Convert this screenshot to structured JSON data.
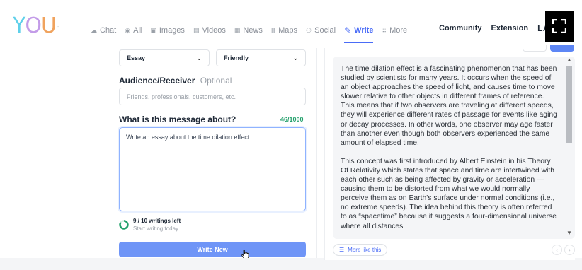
{
  "nav": {
    "logo": {
      "y": "Y",
      "o": "O",
      "u": "U",
      "tm": "™"
    },
    "items": [
      {
        "icon": "chat-icon",
        "glyph": "☁",
        "label": "Chat"
      },
      {
        "icon": "all-icon",
        "glyph": "◉",
        "label": "All"
      },
      {
        "icon": "images-icon",
        "glyph": "▣",
        "label": "Images"
      },
      {
        "icon": "videos-icon",
        "glyph": "▤",
        "label": "Videos"
      },
      {
        "icon": "news-icon",
        "glyph": "▦",
        "label": "News"
      },
      {
        "icon": "maps-icon",
        "glyph": "Ⅲ",
        "label": "Maps"
      },
      {
        "icon": "social-icon",
        "glyph": "⚇",
        "label": "Social"
      },
      {
        "icon": "write-icon",
        "glyph": "✎",
        "label": "Write"
      },
      {
        "icon": "more-icon",
        "glyph": "⠿",
        "label": "More"
      }
    ],
    "active": "Write",
    "right": {
      "community": "Community",
      "extension": "Extension",
      "lang": "LANG"
    }
  },
  "form": {
    "type_select": "Essay",
    "tone_select": "Friendly",
    "audience_label": "Audience/Receiver",
    "audience_optional": "Optional",
    "audience_placeholder": "Friends, professionals, customers, etc.",
    "about_label": "What is this message about?",
    "char_count": "46/1000",
    "about_value": "Write an essay about the time dilation effect.",
    "quota_main": "9 / 10 writings left",
    "quota_sub": "Start writing today",
    "write_new": "Write New"
  },
  "output": {
    "paragraphs": [
      "The time dilation effect is a fascinating phenomenon that has been studied by scientists for many years. It occurs when the speed of an object approaches the speed of light, and causes time to move slower relative to other objects in different frames of reference. This means that if two observers are traveling at different speeds, they will experience different rates of passage for events like aging or decay processes. In other words, one observer may age faster than another even though both observers experienced the same amount of elapsed time.",
      "This concept was first introduced by Albert Einstein in his Theory Of Relativity which states that space and time are intertwined with each other such as being affected by gravity or acceleration — causing them to be distorted from what we would normally perceive them as on Earth's surface under normal conditions (i.e., no extreme speeds). The idea behind this theory is often referred to as “spacetime” because it suggests a four-dimensional universe where all distances"
    ],
    "more_like_this": "More like this"
  },
  "colors": {
    "accent": "#4a6cf7",
    "button": "#6f95f7",
    "success": "#22a06b"
  }
}
